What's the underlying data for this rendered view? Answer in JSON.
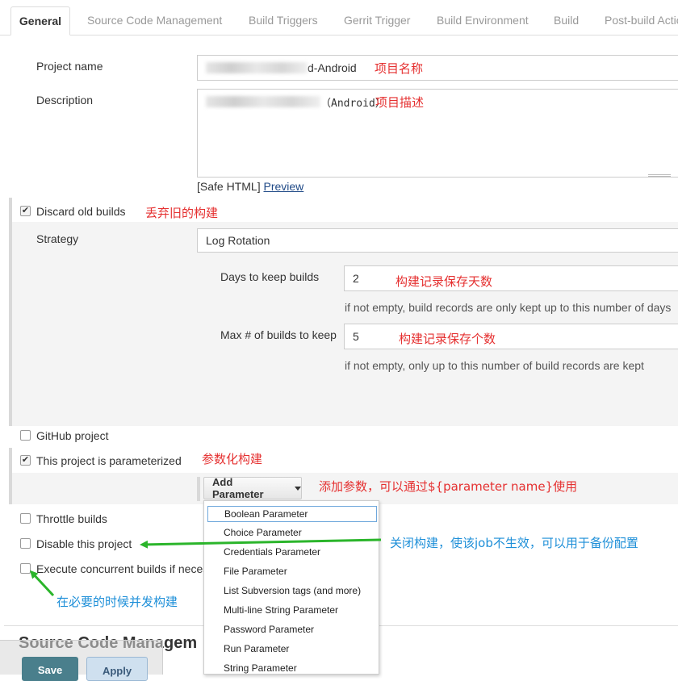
{
  "tabs": [
    {
      "label": "General"
    },
    {
      "label": "Source Code Management"
    },
    {
      "label": "Build Triggers"
    },
    {
      "label": "Gerrit Trigger"
    },
    {
      "label": "Build Environment"
    },
    {
      "label": "Build"
    },
    {
      "label": "Post-build Actions"
    }
  ],
  "project_name": {
    "label": "Project name",
    "value_suffix": "d-Android",
    "annotation": "项目名称"
  },
  "description": {
    "label": "Description",
    "value_suffix": "（Android）",
    "annotation": "项目描述",
    "safe_html": "[Safe HTML]",
    "preview": "Preview"
  },
  "discard": {
    "label": "Discard old builds",
    "checked": true,
    "annotation": "丢弃旧的构建",
    "strategy_label": "Strategy",
    "strategy_value": "Log Rotation",
    "days_label": "Days to keep builds",
    "days_value": "2",
    "days_annotation": "构建记录保存天数",
    "days_help": "if not empty, build records are only kept up to this number of days",
    "max_label": "Max # of builds to keep",
    "max_value": "5",
    "max_annotation": "构建记录保存个数",
    "max_help": "if not empty, only up to this number of build records are kept"
  },
  "options": {
    "github": "GitHub project",
    "parameterized": "This project is parameterized",
    "parameterized_annotation": "参数化构建",
    "throttle": "Throttle builds",
    "disable": "Disable this project",
    "disable_annotation": "关闭构建，使该job不生效，可以用于备份配置",
    "concurrent": "Execute concurrent builds if neces",
    "concurrent_annotation": "在必要的时候并发构建"
  },
  "add_parameter": {
    "label": "Add Parameter",
    "annotation": "添加参数，可以通过${parameter name}使用",
    "items": [
      "Boolean Parameter",
      "Choice Parameter",
      "Credentials Parameter",
      "File Parameter",
      "List Subversion tags (and more)",
      "Multi-line String Parameter",
      "Password Parameter",
      "Run Parameter",
      "String Parameter"
    ]
  },
  "scm_heading": "Source Code Managem",
  "buttons": {
    "save": "Save",
    "apply": "Apply"
  },
  "colors": {
    "annotation_red": "#e53030",
    "annotation_blue": "#1e8fd8",
    "arrow_green": "#2bb52b",
    "save_bg": "#4a7f8c"
  }
}
